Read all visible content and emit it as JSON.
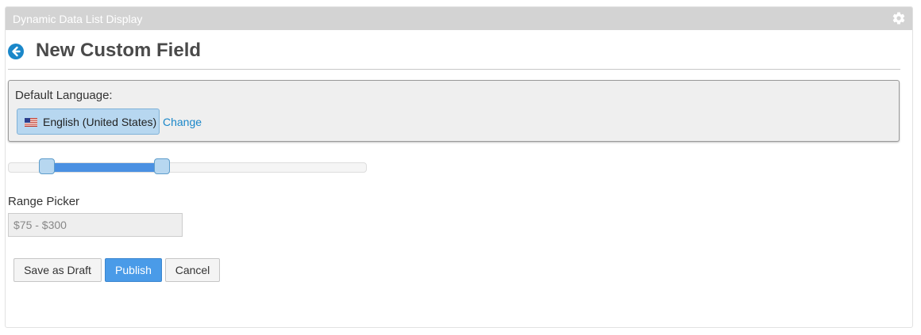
{
  "portlet": {
    "title": "Dynamic Data List Display",
    "settings_icon": "gear-icon"
  },
  "header": {
    "back_icon": "back-arrow-circle-icon",
    "title": "New Custom Field"
  },
  "language": {
    "label": "Default Language:",
    "selected": "English (United States)",
    "flag_icon": "us-flag-icon",
    "change_label": "Change"
  },
  "slider": {
    "min_value": 75,
    "max_value": 300,
    "range_min": 0,
    "range_max": 700
  },
  "range_picker": {
    "label": "Range Picker",
    "value": "$75 - $300"
  },
  "actions": {
    "save_draft_label": "Save as Draft",
    "publish_label": "Publish",
    "cancel_label": "Cancel"
  },
  "colors": {
    "accent": "#4a9be8",
    "topper": "#d3d3d3",
    "link": "#1a87c9",
    "chip": "#b7d7f0"
  }
}
